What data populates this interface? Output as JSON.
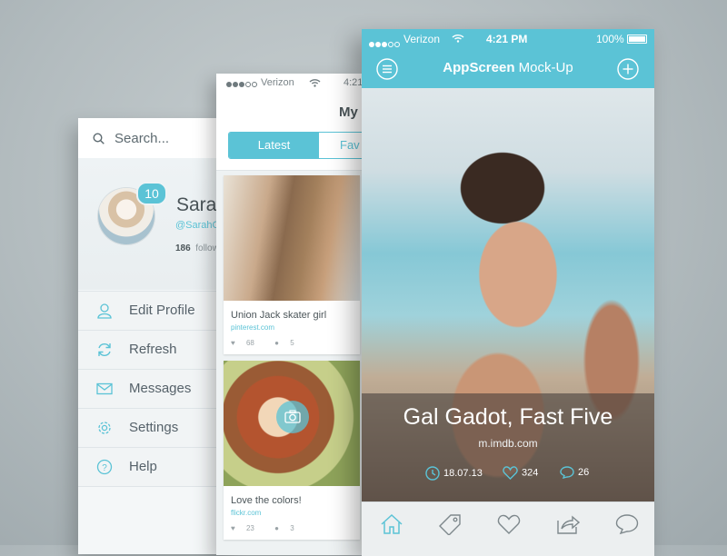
{
  "colors": {
    "accent": "#5bc3d6",
    "text_dark": "#4a5458",
    "background": "#b3bcbf"
  },
  "menu_screen": {
    "search_placeholder": "Search...",
    "profile": {
      "name": "Sarah",
      "handle": "@SarahC",
      "followers_count": "186",
      "followers_label": "followers",
      "badge_count": "10"
    },
    "items": [
      {
        "label": "Edit Profile",
        "icon": "user-icon"
      },
      {
        "label": "Refresh",
        "icon": "refresh-icon"
      },
      {
        "label": "Messages",
        "icon": "mail-icon"
      },
      {
        "label": "Settings",
        "icon": "gear-icon"
      },
      {
        "label": "Help",
        "icon": "help-icon"
      }
    ]
  },
  "feed_screen": {
    "status": {
      "carrier": "Verizon",
      "time": "4:21"
    },
    "title": "My",
    "tabs": {
      "active": "Latest",
      "inactive": "Fav"
    },
    "cards": [
      {
        "title": "Union Jack skater girl",
        "source": "pinterest.com",
        "likes": "68",
        "comments": "5"
      },
      {
        "title": "Love the colors!",
        "source": "flickr.com",
        "likes": "23",
        "comments": "3"
      }
    ]
  },
  "main_screen": {
    "status": {
      "carrier": "Verizon",
      "time": "4:21 PM",
      "battery": "100%"
    },
    "title_bold": "AppScreen",
    "title_rest": " Mock-Up",
    "caption": {
      "title": "Gal Gadot, Fast Five",
      "source": "m.imdb.com",
      "date": "18.07.13",
      "likes": "324",
      "comments": "26"
    },
    "tabbar": [
      "home-icon",
      "tag-icon",
      "heart-icon",
      "share-icon",
      "chat-icon"
    ]
  }
}
